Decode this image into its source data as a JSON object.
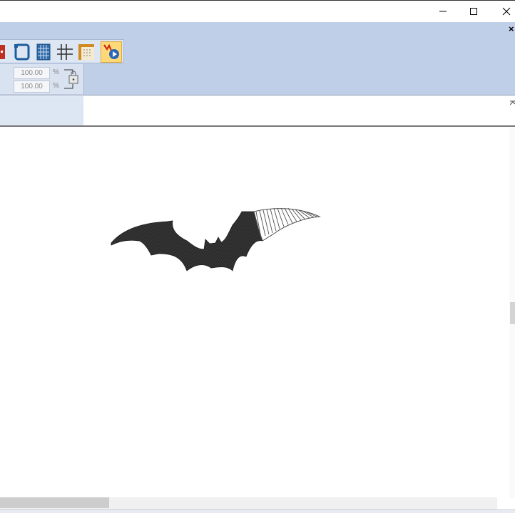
{
  "window": {
    "controls": {
      "minimize_icon": "minimize-icon",
      "maximize_icon": "maximize-icon",
      "close_icon": "close-icon"
    },
    "ribbon_close_label": "×"
  },
  "toolbar": {
    "tools": [
      {
        "icon": "stitch-pattern-icon"
      },
      {
        "icon": "hoop-frame-icon"
      },
      {
        "icon": "grid-sheet-icon"
      },
      {
        "icon": "grid-lines-icon"
      },
      {
        "icon": "ruler-grid-icon"
      },
      {
        "icon": "stitch-simulator-icon",
        "active": true
      }
    ]
  },
  "scale": {
    "x_value": "100.00",
    "y_value": "100.00",
    "unit": "%",
    "lock_icon": "aspect-lock-icon"
  },
  "colors": {
    "ribbon": "#bfcfe7",
    "thread": "#2c2c2c",
    "hatch": "#505050"
  }
}
